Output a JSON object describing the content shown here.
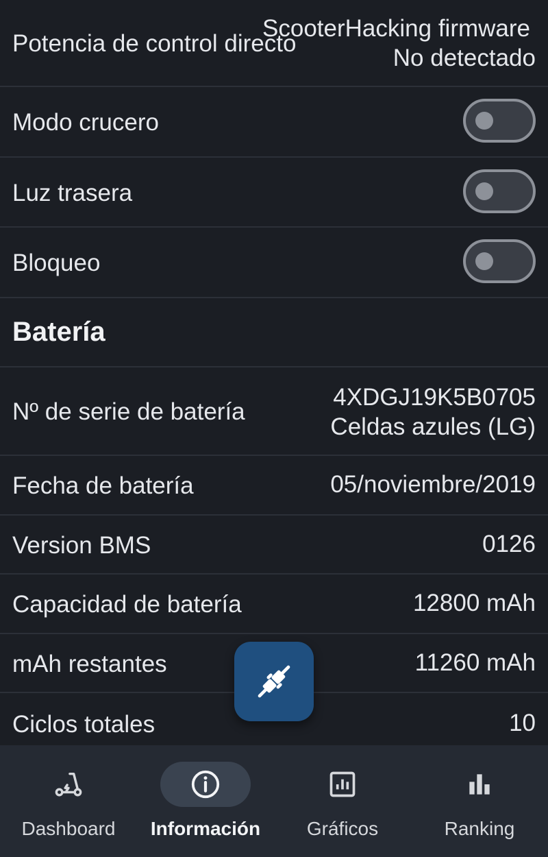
{
  "settings": {
    "direct_power": {
      "label": "Potencia de control directo",
      "value_line1": "ScooterHacking firmware",
      "value_line2": "No detectado"
    },
    "cruise_mode": {
      "label": "Modo crucero",
      "enabled": false
    },
    "tail_light": {
      "label": "Luz trasera",
      "enabled": false
    },
    "lock": {
      "label": "Bloqueo",
      "enabled": false
    }
  },
  "battery": {
    "section_title": "Batería",
    "serial": {
      "label": "Nº de serie de batería",
      "value_line1": "4XDGJ19K5B0705",
      "value_line2": "Celdas azules (LG)"
    },
    "date": {
      "label": "Fecha de batería",
      "value": "05/noviembre/2019"
    },
    "bms": {
      "label": "Version BMS",
      "value": "0126"
    },
    "capacity": {
      "label": "Capacidad de batería",
      "value": "12800 mAh"
    },
    "remaining": {
      "label": "mAh restantes",
      "value": "11260 mAh"
    },
    "cycles": {
      "label": "Ciclos totales",
      "value": "10"
    }
  },
  "fab": {
    "icon": "plug-disconnected-icon"
  },
  "nav": {
    "active": "info",
    "items": [
      {
        "id": "dashboard",
        "label": "Dashboard",
        "icon": "scooter-icon"
      },
      {
        "id": "info",
        "label": "Información",
        "icon": "info-icon"
      },
      {
        "id": "charts",
        "label": "Gráficos",
        "icon": "chart-icon"
      },
      {
        "id": "ranking",
        "label": "Ranking",
        "icon": "bar-chart-icon"
      }
    ]
  },
  "colors": {
    "background": "#1b1e24",
    "divider": "#2c3038",
    "fab": "#1f4f7f",
    "nav_background": "#252a33",
    "nav_active_pill": "#3a4350"
  }
}
